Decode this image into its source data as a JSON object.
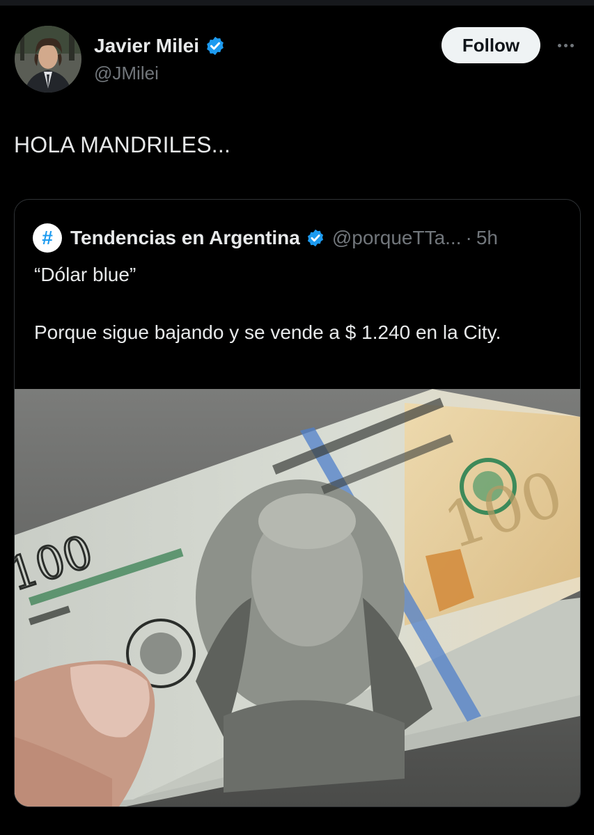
{
  "author": {
    "name": "Javier Milei",
    "handle": "@JMilei",
    "verified_icon": "verified-badge-icon"
  },
  "actions": {
    "follow_label": "Follow",
    "more_icon": "more-options-icon"
  },
  "tweet": {
    "text": "HOLA MANDRILES..."
  },
  "quoted": {
    "avatar_symbol": "#",
    "name": "Tendencias en Argentina",
    "handle": "@porqueTTa...",
    "separator": "·",
    "time": "5h",
    "line1": "“Dólar blue”",
    "line2": "Porque sigue bajando y se vende a $ 1.240 en la City.",
    "image_icon": "dollar-bill-photo"
  },
  "colors": {
    "background": "#000000",
    "text": "#e7e9ea",
    "muted": "#71767b",
    "verified": "#1d9bf0",
    "border": "#2f3336"
  }
}
